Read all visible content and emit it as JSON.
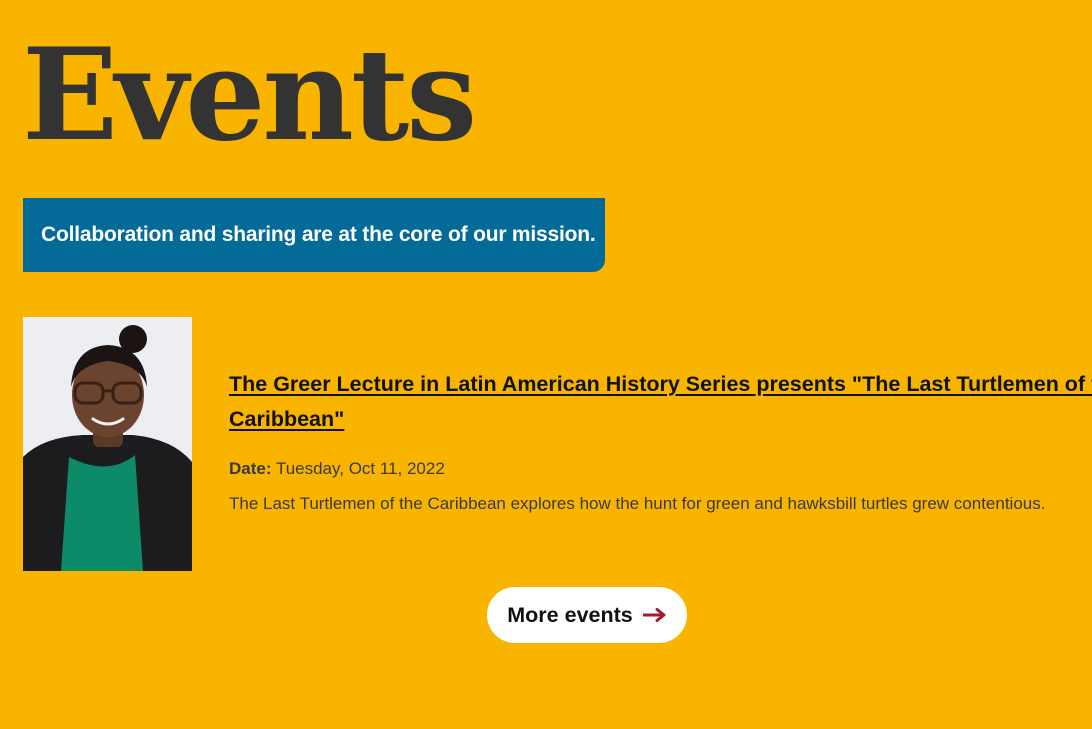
{
  "page": {
    "title": "Events",
    "mission": "Collaboration and sharing are at the core of our mission."
  },
  "event": {
    "title": "The Greer Lecture in Latin American History Series presents \"The Last Turtlemen of the Caribbean\"",
    "date_label": "Date:",
    "date_value": "Tuesday, Oct 11, 2022",
    "summary": "The Last Turtlemen of the Caribbean explores how the hunt for green and hawksbill turtles grew contentious.",
    "photo_icon": "speaker-portrait"
  },
  "more_button": {
    "label": "More events",
    "icon": "arrow-right-icon"
  },
  "colors": {
    "background": "#F9B400",
    "banner": "#046B99",
    "title_text": "#333333",
    "arrow": "#A6192E",
    "button_bg": "#FFFFFF"
  }
}
